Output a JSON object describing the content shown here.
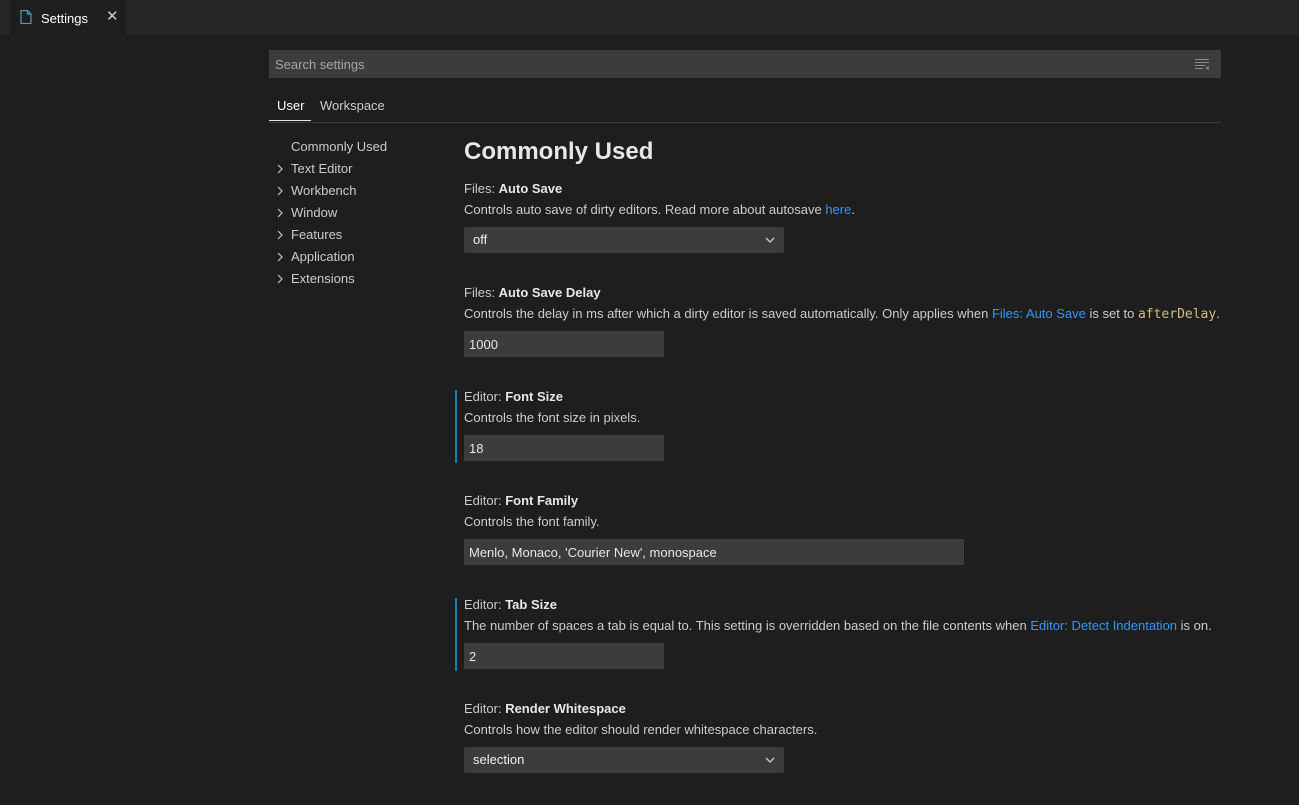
{
  "tab": {
    "title": "Settings",
    "close_glyph": "✕",
    "icon": "file-icon"
  },
  "search": {
    "placeholder": "Search settings",
    "value": "",
    "clear_icon": "clear-filter-icon"
  },
  "scope_tabs": {
    "user": "User",
    "workspace": "Workspace",
    "active": "User"
  },
  "toc": [
    {
      "label": "Commonly Used",
      "expandable": false
    },
    {
      "label": "Text Editor",
      "expandable": true
    },
    {
      "label": "Workbench",
      "expandable": true
    },
    {
      "label": "Window",
      "expandable": true
    },
    {
      "label": "Features",
      "expandable": true
    },
    {
      "label": "Application",
      "expandable": true
    },
    {
      "label": "Extensions",
      "expandable": true
    }
  ],
  "section_title": "Commonly Used",
  "settings": {
    "auto_save": {
      "category": "Files: ",
      "key": "Auto Save",
      "desc_prefix": "Controls auto save of dirty editors. Read more about autosave ",
      "desc_link": "here",
      "desc_suffix": ".",
      "value": "off",
      "modified": false
    },
    "auto_save_delay": {
      "category": "Files: ",
      "key": "Auto Save Delay",
      "desc_prefix": "Controls the delay in ms after which a dirty editor is saved automatically. Only applies when ",
      "desc_link": "Files: Auto Save",
      "desc_middle": " is set to ",
      "desc_code": "afterDelay",
      "desc_suffix": ".",
      "value": "1000",
      "modified": false
    },
    "font_size": {
      "category": "Editor: ",
      "key": "Font Size",
      "desc": "Controls the font size in pixels.",
      "value": "18",
      "modified": true
    },
    "font_family": {
      "category": "Editor: ",
      "key": "Font Family",
      "desc": "Controls the font family.",
      "value": "Menlo, Monaco, 'Courier New', monospace",
      "modified": false
    },
    "tab_size": {
      "category": "Editor: ",
      "key": "Tab Size",
      "desc_prefix": "The number of spaces a tab is equal to. This setting is overridden based on the file contents when ",
      "desc_link": "Editor: Detect Indentation",
      "desc_suffix": " is on.",
      "value": "2",
      "modified": true
    },
    "render_whitespace": {
      "category": "Editor: ",
      "key": "Render Whitespace",
      "desc": "Controls how the editor should render whitespace characters.",
      "value": "selection",
      "modified": false
    }
  },
  "colors": {
    "accent_link": "#3794ff",
    "modified_indicator": "#0e7fbf",
    "code": "#d7ba7d"
  }
}
